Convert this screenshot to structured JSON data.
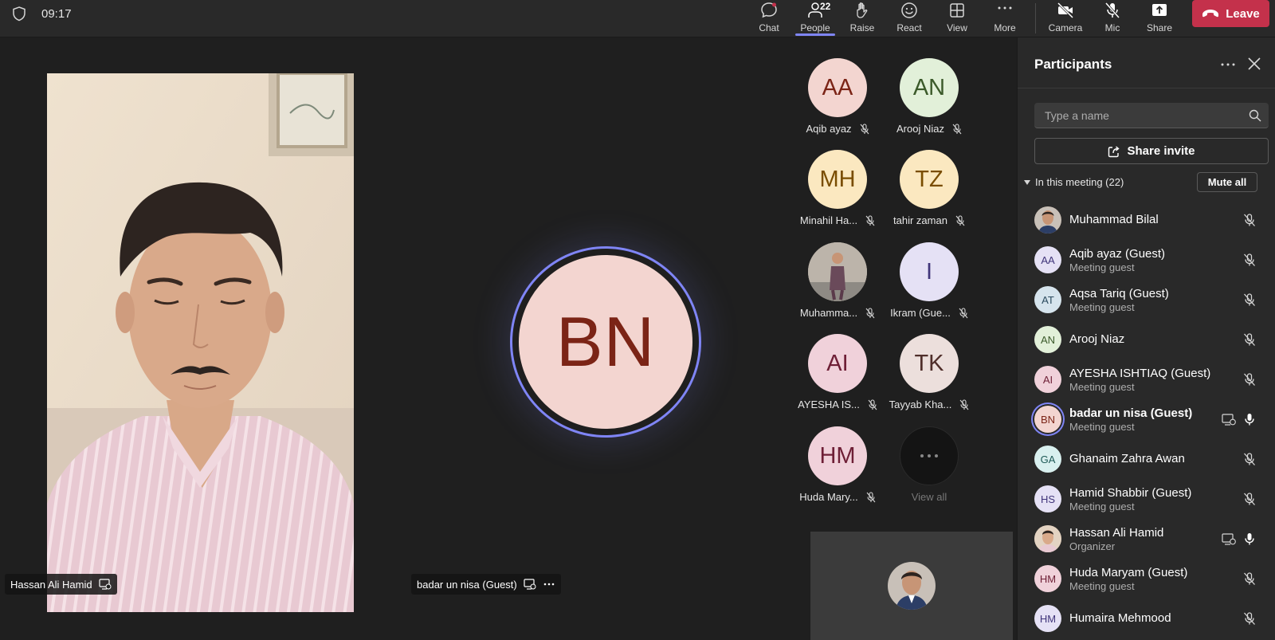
{
  "topbar": {
    "clock": "09:17",
    "buttons": {
      "chat": "Chat",
      "people": "People",
      "people_count": "22",
      "raise": "Raise",
      "react": "React",
      "view": "View",
      "more": "More",
      "camera": "Camera",
      "mic": "Mic",
      "share": "Share",
      "leave": "Leave"
    }
  },
  "stage": {
    "video_name": "Hassan Ali Hamid",
    "center_initials": "BN",
    "center_name": "badar un nisa (Guest)",
    "gallery": [
      {
        "initials": "AA",
        "name": "Aqib ayaz",
        "bg": "#f3d5d0",
        "fg": "#7b2416"
      },
      {
        "initials": "AN",
        "name": "Arooj Niaz",
        "bg": "#e2f0d9",
        "fg": "#3b5a2a"
      },
      {
        "initials": "MH",
        "name": "Minahil Ha...",
        "bg": "#fbe8c0",
        "fg": "#7a4d00"
      },
      {
        "initials": "TZ",
        "name": "tahir zaman",
        "bg": "#fbe8c0",
        "fg": "#7a4d00"
      },
      {
        "initials": "",
        "name": "Muhamma...",
        "bg": "#b8b0a8",
        "fg": "#ffffff"
      },
      {
        "initials": "I",
        "name": "Ikram (Gue...",
        "bg": "#e5e1f5",
        "fg": "#40357a"
      },
      {
        "initials": "AI",
        "name": "AYESHA IS...",
        "bg": "#f0d1da",
        "fg": "#6e1f36"
      },
      {
        "initials": "TK",
        "name": "Tayyab Kha...",
        "bg": "#ecdfdc",
        "fg": "#4f2e2a"
      },
      {
        "initials": "HM",
        "name": "Huda Mary...",
        "bg": "#f0d1da",
        "fg": "#6e1f36"
      },
      {
        "initials": "",
        "name": "View all",
        "bg": "#141414",
        "fg": "#888888"
      }
    ]
  },
  "panel": {
    "title": "Participants",
    "search_placeholder": "Type a name",
    "share_invite": "Share invite",
    "section_label": "In this meeting (22)",
    "mute_all": "Mute all",
    "participants": [
      {
        "initials": "",
        "name": "Muhammad Bilal",
        "sub": "",
        "bg": "#6b4a3a",
        "fg": "#ffffff",
        "mic": "muted"
      },
      {
        "initials": "AA",
        "name": "Aqib ayaz (Guest)",
        "sub": "Meeting guest",
        "bg": "#e5e1f5",
        "fg": "#40357a",
        "mic": "muted"
      },
      {
        "initials": "AT",
        "name": "Aqsa Tariq (Guest)",
        "sub": "Meeting guest",
        "bg": "#d6e4ed",
        "fg": "#2b4a5e",
        "mic": "muted"
      },
      {
        "initials": "AN",
        "name": "Arooj Niaz",
        "sub": "",
        "bg": "#e2f0d9",
        "fg": "#3b5a2a",
        "mic": "muted"
      },
      {
        "initials": "AI",
        "name": "AYESHA ISHTIAQ (Guest)",
        "sub": "Meeting guest",
        "bg": "#f0d1da",
        "fg": "#6e1f36",
        "mic": "muted"
      },
      {
        "initials": "BN",
        "name": "badar un nisa (Guest)",
        "sub": "Meeting guest",
        "bg": "#f3d5d0",
        "fg": "#7b2416",
        "mic": "on",
        "speaking": true,
        "sharing": true
      },
      {
        "initials": "GA",
        "name": "Ghanaim Zahra Awan",
        "sub": "",
        "bg": "#d9f0ef",
        "fg": "#1f5a57",
        "mic": "muted"
      },
      {
        "initials": "HS",
        "name": "Hamid Shabbir (Guest)",
        "sub": "Meeting guest",
        "bg": "#e5e1f5",
        "fg": "#40357a",
        "mic": "muted"
      },
      {
        "initials": "",
        "name": "Hassan Ali Hamid",
        "sub": "Organizer",
        "bg": "#a88a72",
        "fg": "#ffffff",
        "mic": "on",
        "sharing": true
      },
      {
        "initials": "HM",
        "name": "Huda Maryam (Guest)",
        "sub": "Meeting guest",
        "bg": "#f0d1da",
        "fg": "#6e1f36",
        "mic": "muted"
      },
      {
        "initials": "HM",
        "name": "Humaira Mehmood",
        "sub": "",
        "bg": "#e5e1f5",
        "fg": "#40357a",
        "mic": "muted"
      }
    ]
  }
}
